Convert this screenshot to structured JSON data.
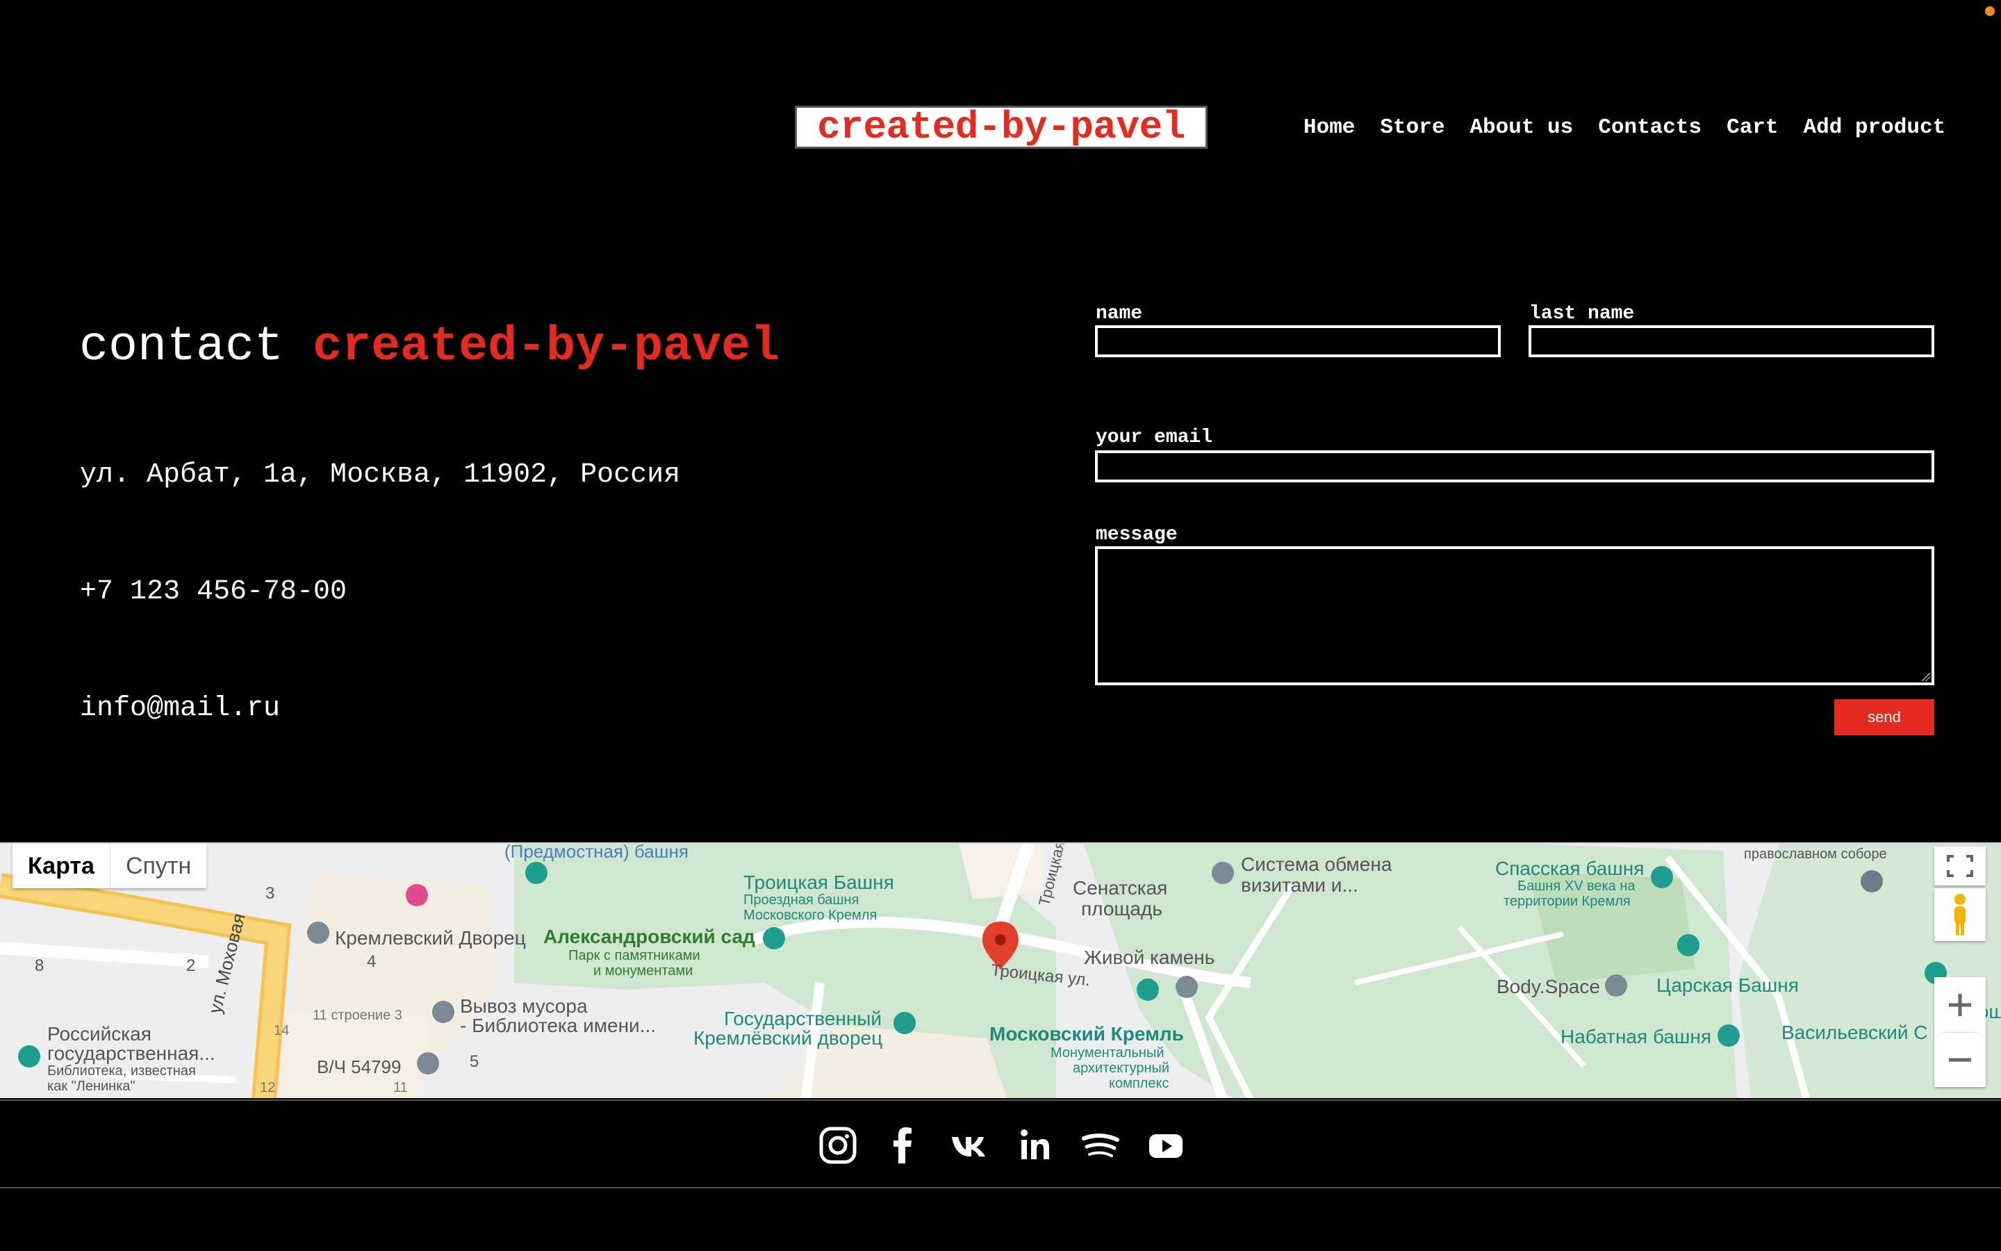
{
  "header": {
    "logo": "created-by-pavel",
    "nav": [
      "Home",
      "Store",
      "About us",
      "Contacts",
      "Cart",
      "Add product"
    ]
  },
  "contact": {
    "title_prefix": "contact",
    "title_brand": "created-by-pavel",
    "address": "ул. Арбат, 1а, Москва, 11902, Россия",
    "phone": "+7 123 456-78-00",
    "email": "info@mail.ru"
  },
  "form": {
    "name_label": "name",
    "last_name_label": "last name",
    "email_label": "your email",
    "message_label": "message",
    "name_value": "",
    "last_name_value": "",
    "email_value": "",
    "message_value": "",
    "send_label": "send"
  },
  "map": {
    "type_map": "Карта",
    "type_satellite": "Спутн",
    "labels": {
      "predmostnaya": "(Предмостная) башня",
      "troitskaya_bashnya": "Троицкая Башня",
      "troitskaya_sub1": "Проездная башня",
      "troitskaya_sub2": "Московского Кремля",
      "senatskaya1": "Сенатская",
      "senatskaya2": "площадь",
      "sistema1": "Система обмена",
      "sistema2": "визитами и...",
      "spasskaya": "Спасская башня",
      "spasskaya_sub1": "Башня XV века на",
      "spasskaya_sub2": "территории Кремля",
      "pravoslav": "православном соборе",
      "kremlevsky_dvorets": "Кремлевский Дворец",
      "aleksandrovsky": "Александровский сад",
      "aleks_sub1": "Парк с памятниками",
      "aleks_sub2": "и монументами",
      "troitskaya_ul": "Троицкая ул.",
      "zhivoy_kamen": "Живой камень",
      "body_space": "Body.Space",
      "tsarskaya": "Царская Башня",
      "plosh": "Плош",
      "vyvoz1": "Вывоз мусора",
      "vyvoz2": "- Библиотека имени...",
      "gos1": "Государственный",
      "gos2": "Кремлёвский дворец",
      "moskovsky_kreml": "Московский Кремль",
      "mk_sub1": "Монументальный",
      "mk_sub2": "архитектурный",
      "mk_sub3": "комплекс",
      "nabatnaya": "Набатная башня",
      "vasilievsky": "Васильевский С",
      "rossiyskaya1": "Российская",
      "rossiyskaya2": "государственная...",
      "ross_sub1": "Библиотека, известная",
      "ross_sub2": "как \"Ленинка\"",
      "mokhovaya": "ул. Моховая",
      "stroenie": "11 строение 3",
      "vch": "В/Ч 54799",
      "n3": "3",
      "n8": "8",
      "n2": "2",
      "n4": "4",
      "n5": "5",
      "n14": "14",
      "n12": "12",
      "n11": "11",
      "troitskaya_vert": "Троицкая ул."
    }
  },
  "footer": {
    "icons": [
      "instagram-icon",
      "facebook-icon",
      "vk-icon",
      "linkedin-icon",
      "spotify-icon",
      "youtube-icon"
    ]
  },
  "colors": {
    "brand_red": "#e52b20",
    "background": "#000000",
    "text": "#ffffff"
  }
}
